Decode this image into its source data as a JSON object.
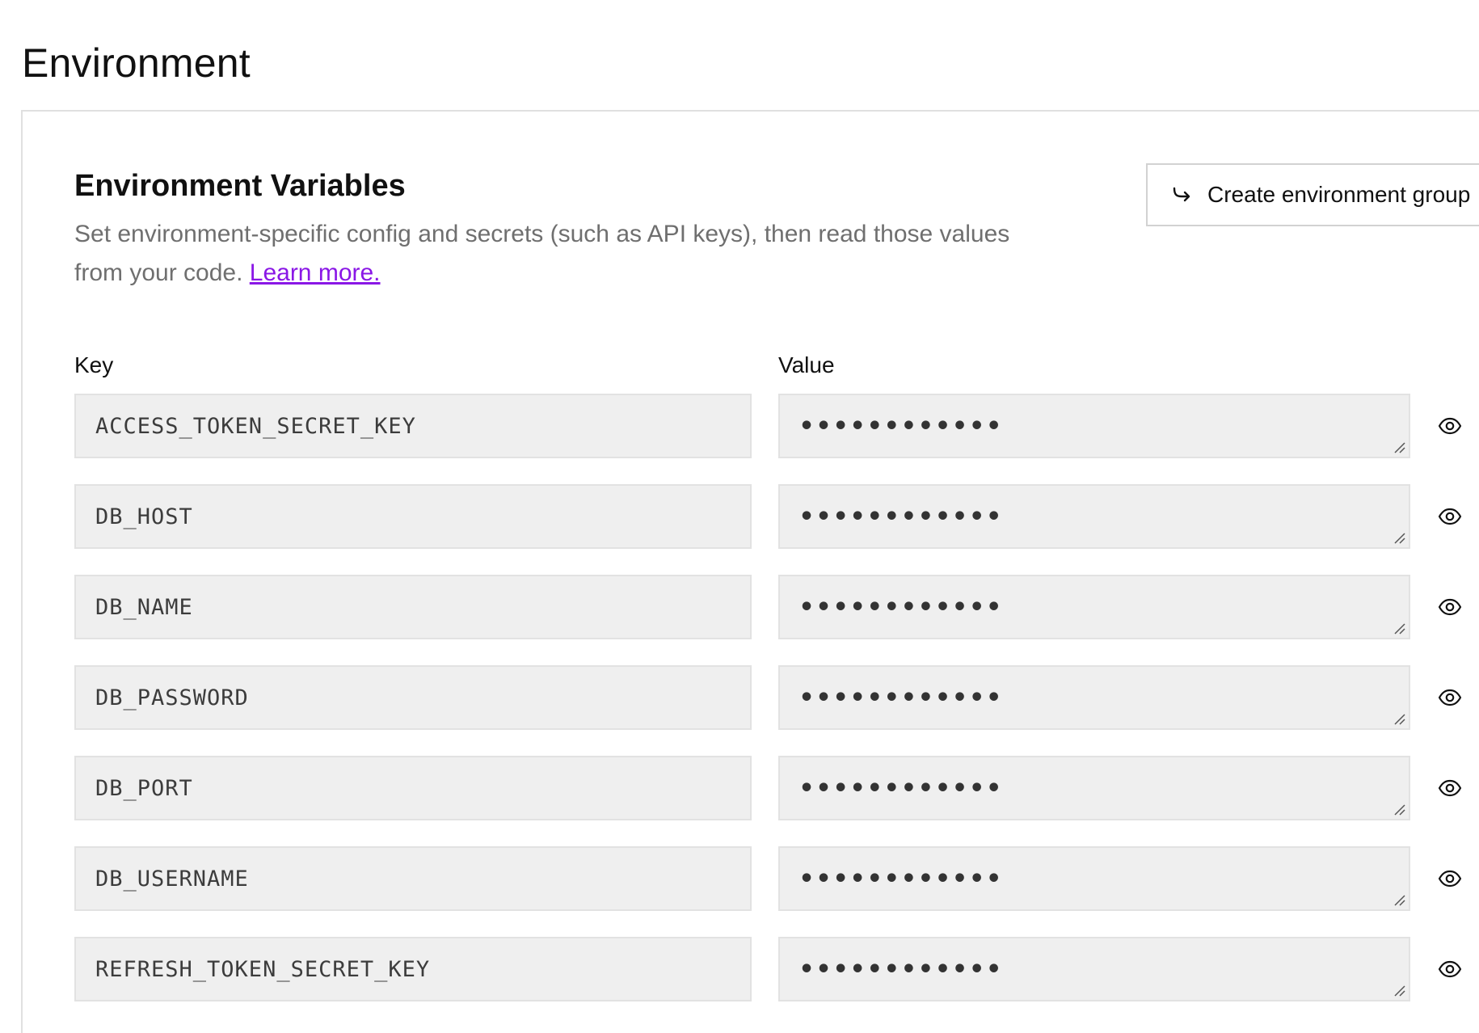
{
  "page": {
    "title": "Environment"
  },
  "env_section": {
    "title": "Environment Variables",
    "description": "Set environment-specific config and secrets (such as API keys), then read those values from your code.",
    "learn_more": "Learn more.",
    "create_group_button": "Create environment group",
    "create_group_icon": "arrow-return-icon",
    "key_label": "Key",
    "value_label": "Value",
    "rows": [
      {
        "key": "ACCESS_TOKEN_SECRET_KEY",
        "value": "••••••••••••"
      },
      {
        "key": "DB_HOST",
        "value": "••••••••••••"
      },
      {
        "key": "DB_NAME",
        "value": "••••••••••••"
      },
      {
        "key": "DB_PASSWORD",
        "value": "••••••••••••"
      },
      {
        "key": "DB_PORT",
        "value": "••••••••••••"
      },
      {
        "key": "DB_USERNAME",
        "value": "••••••••••••"
      },
      {
        "key": "REFRESH_TOKEN_SECRET_KEY",
        "value": "••••••••••••"
      }
    ]
  },
  "colors": {
    "link": "#8a17e6",
    "field_background": "#efefef",
    "muted_text": "#6f6f6f"
  }
}
